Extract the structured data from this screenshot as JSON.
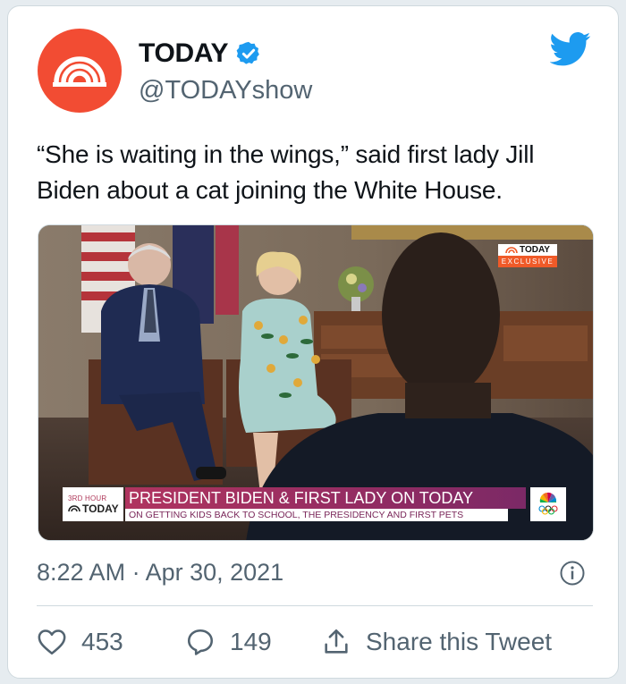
{
  "author": {
    "display_name": "TODAY",
    "handle": "@TODAYshow",
    "verified": true,
    "avatar_icon": "today-logo-icon",
    "avatar_color": "#f24c33"
  },
  "platform_icon": "twitter-bird-icon",
  "tweet": {
    "text": "“She is waiting in the wings,” said first lady Jill Biden about a cat joining the White House."
  },
  "media": {
    "corner_bug": {
      "brand": "TODAY",
      "tag": "EXCLUSIVE"
    },
    "lower_third": {
      "show_line": "3RD HOUR",
      "show_brand": "TODAY",
      "headline": "PRESIDENT BIDEN & FIRST LADY ON TODAY",
      "subheadline": "ON GETTING KIDS BACK TO SCHOOL, THE PRESIDENCY AND FIRST PETS",
      "network_icon": "nbc-peacock-olympics-icon"
    }
  },
  "timestamp": "8:22 AM · Apr 30, 2021",
  "actions": {
    "like_count": "453",
    "reply_count": "149",
    "share_label": "Share this Tweet"
  },
  "colors": {
    "twitter_blue": "#1d9bf0",
    "secondary_text": "#536471",
    "border": "#cfd9de"
  }
}
